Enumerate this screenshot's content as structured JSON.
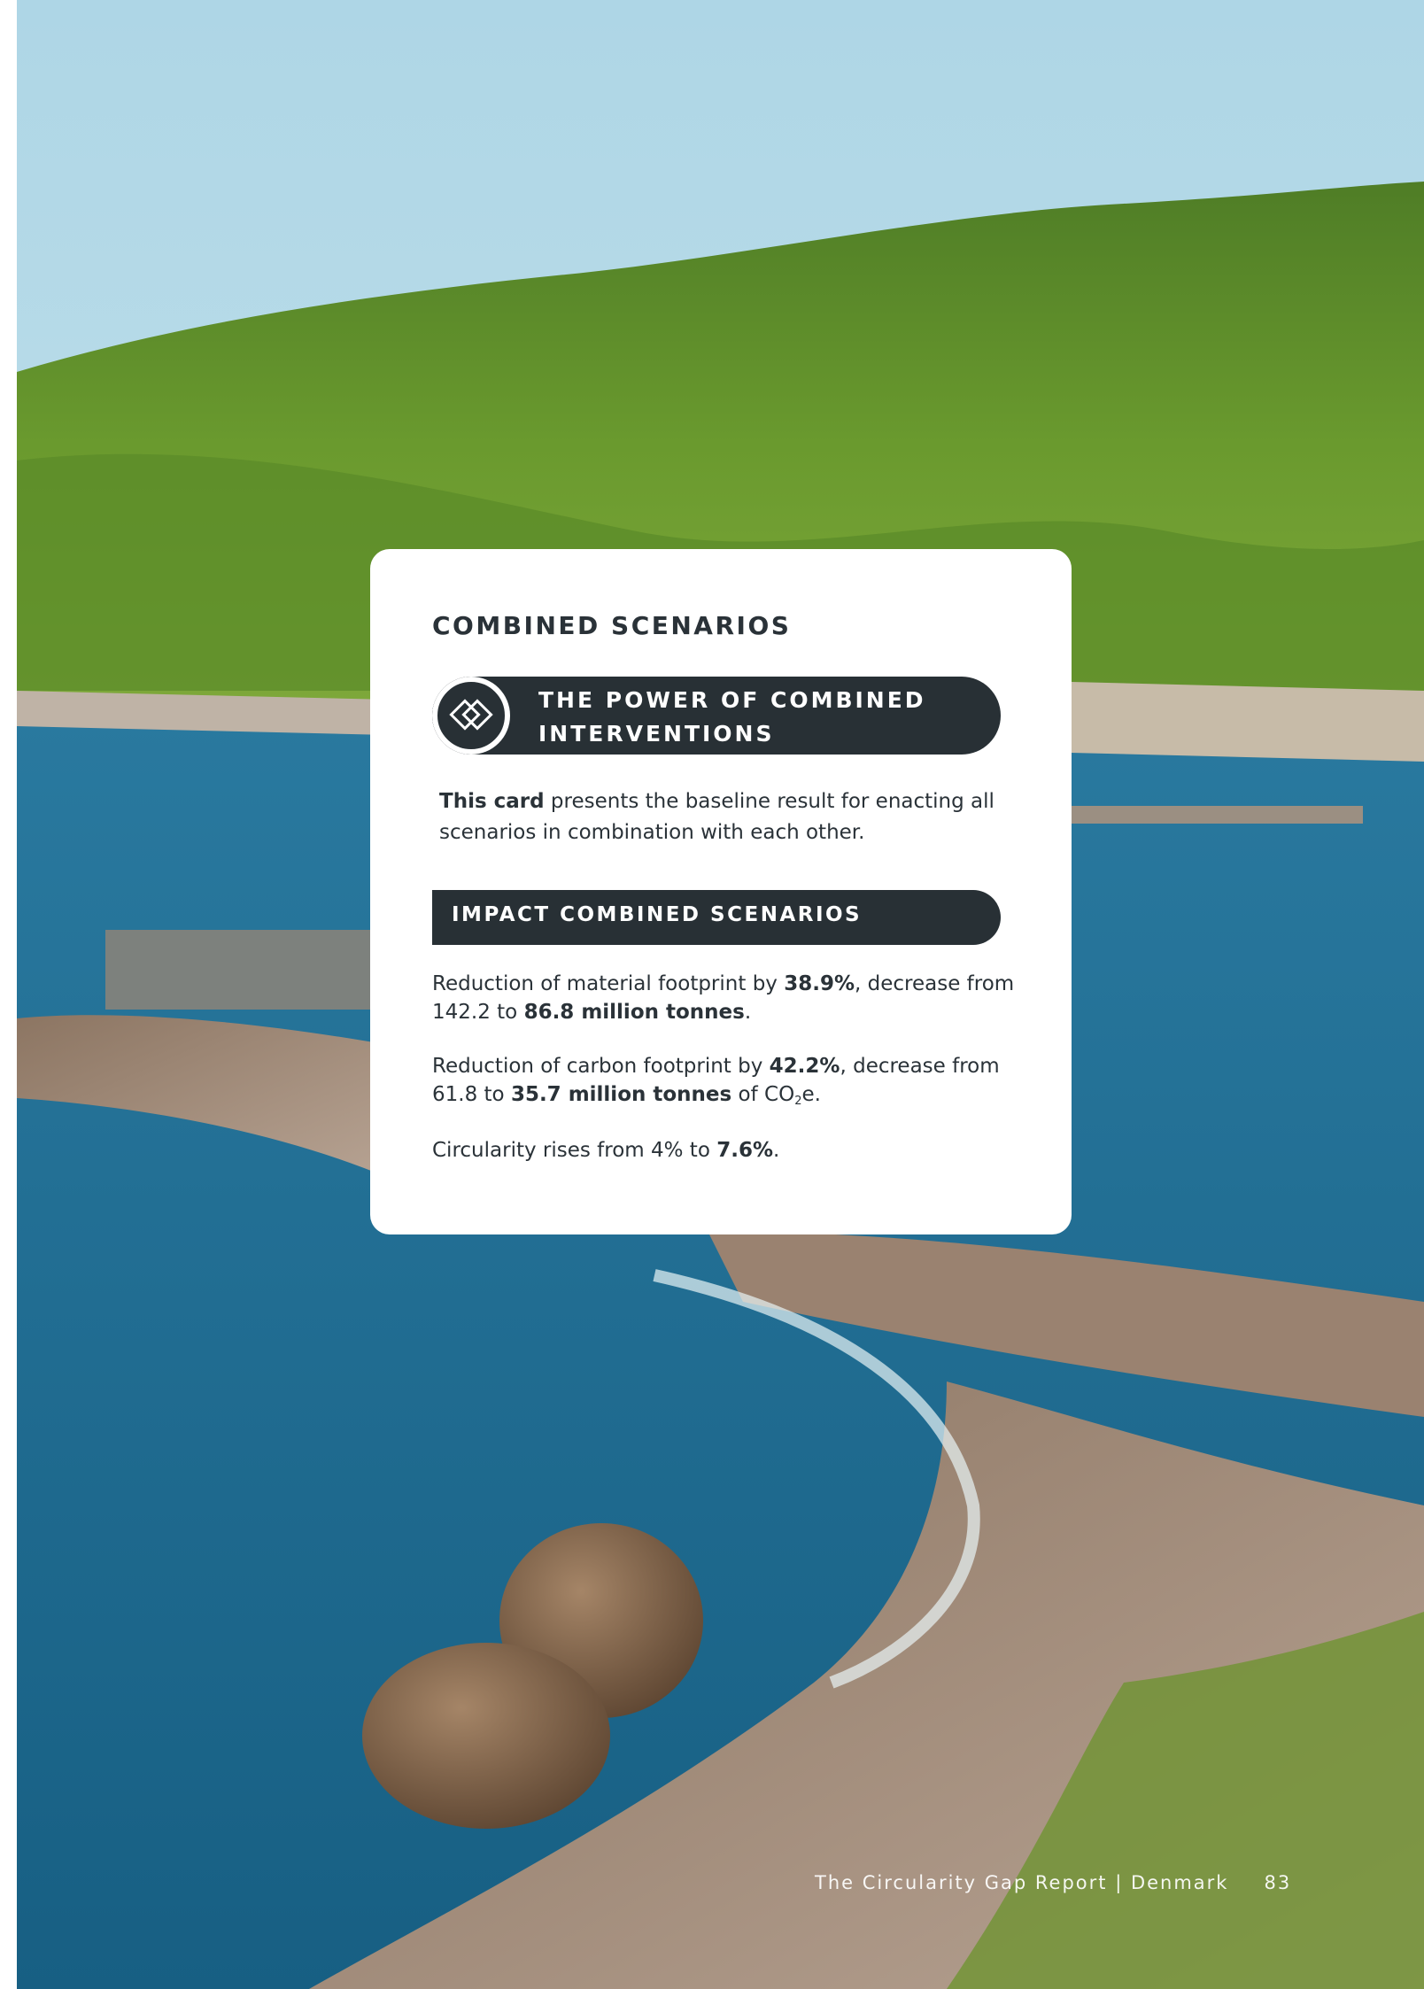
{
  "card": {
    "title": "COMBINED SCENARIOS",
    "pill_line1": "THE POWER OF COMBINED",
    "pill_line2": "INTERVENTIONS",
    "pill_icon": "interlocking-diamonds-icon",
    "intro_bold": "This card",
    "intro_rest": " presents the baseline result for enacting all scenarios in combination with each other.",
    "impact_heading": "IMPACT COMBINED SCENARIOS",
    "material": {
      "prefix": "Reduction of material footprint by ",
      "pct": "38.9%",
      "mid": ", decrease from 142.2 to ",
      "value": "86.8 million tonnes",
      "suffix": "."
    },
    "carbon": {
      "prefix": "Reduction of carbon footprint by ",
      "pct": "42.2%",
      "mid": ", decrease from 61.8 to ",
      "value": "35.7 million tonnes",
      "unit_pre": " of CO",
      "unit_sub": "2",
      "unit_post": "e."
    },
    "circularity": {
      "prefix": "Circularity rises from 4% to ",
      "value": "7.6%",
      "suffix": "."
    }
  },
  "footer": {
    "report": "The Circularity Gap Report | Denmark",
    "page_number": "83"
  },
  "colors": {
    "dark": "#283035",
    "text": "#2a3238",
    "card": "#ffffff"
  }
}
